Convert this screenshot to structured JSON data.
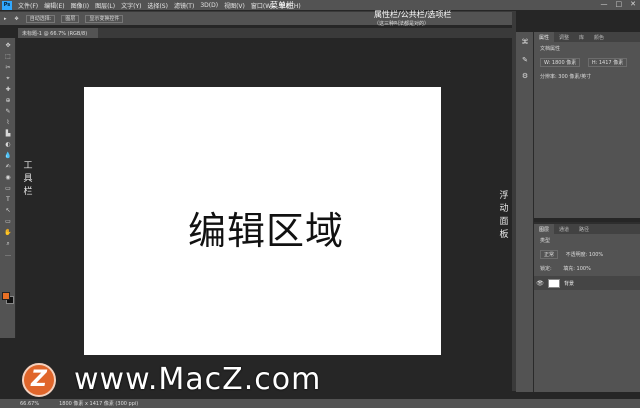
{
  "menubar": {
    "logo": "Ps",
    "items": [
      "文件(F)",
      "编辑(E)",
      "图像(I)",
      "图层(L)",
      "文字(Y)",
      "选择(S)",
      "滤镜(T)",
      "3D(D)",
      "视图(V)",
      "窗口(W)",
      "帮助(H)"
    ],
    "annotation": "菜单栏",
    "window_controls": [
      "—",
      "□",
      "✕"
    ]
  },
  "optionsbar": {
    "items": [
      "▸",
      "✥",
      "自动选择:",
      "图层",
      "显示变换控件"
    ],
    "annotation": "属性栏/公共栏/选项栏",
    "annotation_sub": "（这三种叫法都是对的）"
  },
  "doc_tab": {
    "title": "未标题-1 @ 66.7% (RGB/8)"
  },
  "toolbar": {
    "annotation": [
      "工",
      "具",
      "栏"
    ],
    "tools": [
      "✥",
      "⬚",
      "✂",
      "⌖",
      "✚",
      "⊕",
      "✎",
      "⌇",
      "▙",
      "◐",
      "💧",
      "✍",
      "◉",
      "▭",
      "T",
      "↖",
      "▭",
      "✋",
      "⌕",
      "…"
    ]
  },
  "canvas": {
    "label": "编辑区域"
  },
  "floating_panels": {
    "annotation": [
      "浮",
      "动",
      "面",
      "板"
    ],
    "properties": {
      "tabs": [
        "属性",
        "调整",
        "库",
        "颜色"
      ],
      "doc_label": "文档属性",
      "width_label": "W: 1800 像素",
      "height_label": "H: 1417 像素",
      "resolution": "分辨率: 300 像素/英寸"
    },
    "layers": {
      "tabs": [
        "图层",
        "通道",
        "路径"
      ],
      "kind_filter": "类型",
      "blend_mode": "正常",
      "opacity": "不透明度: 100%",
      "lock_label": "锁定:",
      "fill": "填充: 100%",
      "layer_name": "背景"
    }
  },
  "statusbar": {
    "zoom": "66.67%",
    "doc_info": "1800 像素 x 1417 像素 (300 ppi)"
  },
  "watermark": {
    "logo_letter": "Z",
    "text": "www.MacZ.com"
  },
  "colors": {
    "panel": "#535353",
    "workspace": "#262626",
    "fg_swatch": "#e87025",
    "watermark_logo": "#e0662b"
  }
}
